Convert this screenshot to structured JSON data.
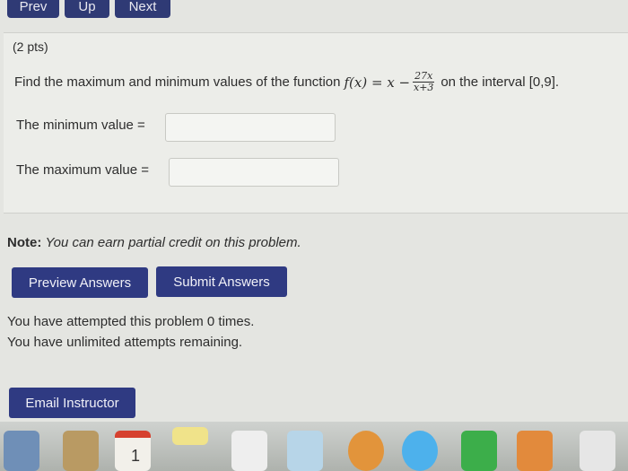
{
  "nav": {
    "prev": "Prev",
    "up": "Up",
    "next": "Next"
  },
  "problem": {
    "points": "(2 pts)",
    "prompt_start": "Find the maximum and minimum values of the function",
    "function_lhs": "f(x) = x −",
    "fraction_numerator": "27x",
    "fraction_denominator": "x+3",
    "prompt_end": "on the interval [0,9].",
    "minimum_label": "The minimum value =",
    "minimum_value": "",
    "maximum_label": "The maximum value =",
    "maximum_value": ""
  },
  "note": {
    "label": "Note:",
    "text": "You can earn partial credit on this problem."
  },
  "buttons": {
    "preview": "Preview Answers",
    "submit": "Submit Answers",
    "email": "Email Instructor"
  },
  "status": {
    "attempts": "You have attempted this problem 0 times.",
    "remaining": "You have unlimited attempts remaining."
  },
  "dock": {
    "icons": [
      "finder-icon",
      "notes-icon",
      "calendar-icon",
      "stickies-icon",
      "reminders-icon",
      "preview-icon",
      "photos-icon",
      "messages-icon",
      "facetime-icon",
      "books-icon",
      "numbers-icon"
    ],
    "calendar_day": "1"
  },
  "colors": {
    "button_blue": "#2f3a82",
    "background": "#e4e5e1"
  }
}
